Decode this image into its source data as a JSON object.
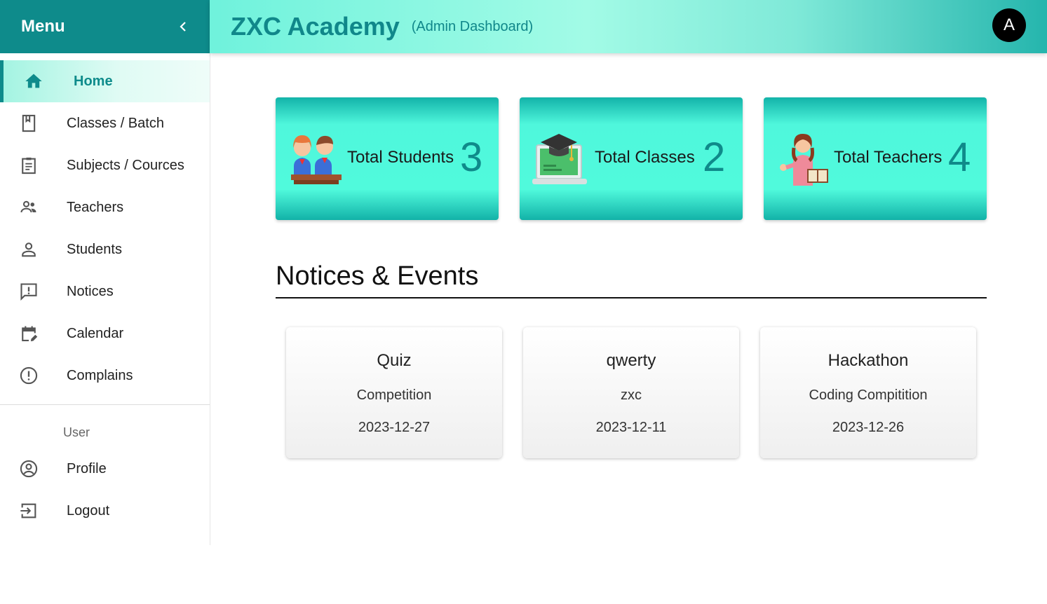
{
  "sidebar": {
    "menu_title": "Menu",
    "items": [
      {
        "label": "Home",
        "icon": "home-icon"
      },
      {
        "label": "Classes / Batch",
        "icon": "bookmark-icon"
      },
      {
        "label": "Subjects / Cources",
        "icon": "clipboard-icon"
      },
      {
        "label": "Teachers",
        "icon": "people-icon"
      },
      {
        "label": "Students",
        "icon": "person-icon"
      },
      {
        "label": "Notices",
        "icon": "announcement-icon"
      },
      {
        "label": "Calendar",
        "icon": "calendar-edit-icon"
      },
      {
        "label": "Complains",
        "icon": "error-outline-icon"
      }
    ],
    "user_section": "User",
    "user_items": [
      {
        "label": "Profile",
        "icon": "account-circle-icon"
      },
      {
        "label": "Logout",
        "icon": "logout-icon"
      }
    ]
  },
  "header": {
    "title": "ZXC Academy",
    "subtitle": "(Admin Dashboard)",
    "avatar_initial": "A"
  },
  "stats": [
    {
      "label": "Total Students",
      "value": "3"
    },
    {
      "label": "Total Classes",
      "value": "2"
    },
    {
      "label": "Total Teachers",
      "value": "4"
    }
  ],
  "notices": {
    "title": "Notices & Events",
    "items": [
      {
        "title": "Quiz",
        "description": "Competition",
        "date": "2023-12-27"
      },
      {
        "title": "qwerty",
        "description": "zxc",
        "date": "2023-12-11"
      },
      {
        "title": "Hackathon",
        "description": "Coding Compitition",
        "date": "2023-12-26"
      }
    ]
  },
  "colors": {
    "primary": "#0e8b8b",
    "accent": "#50fadc",
    "text": "#222222"
  }
}
